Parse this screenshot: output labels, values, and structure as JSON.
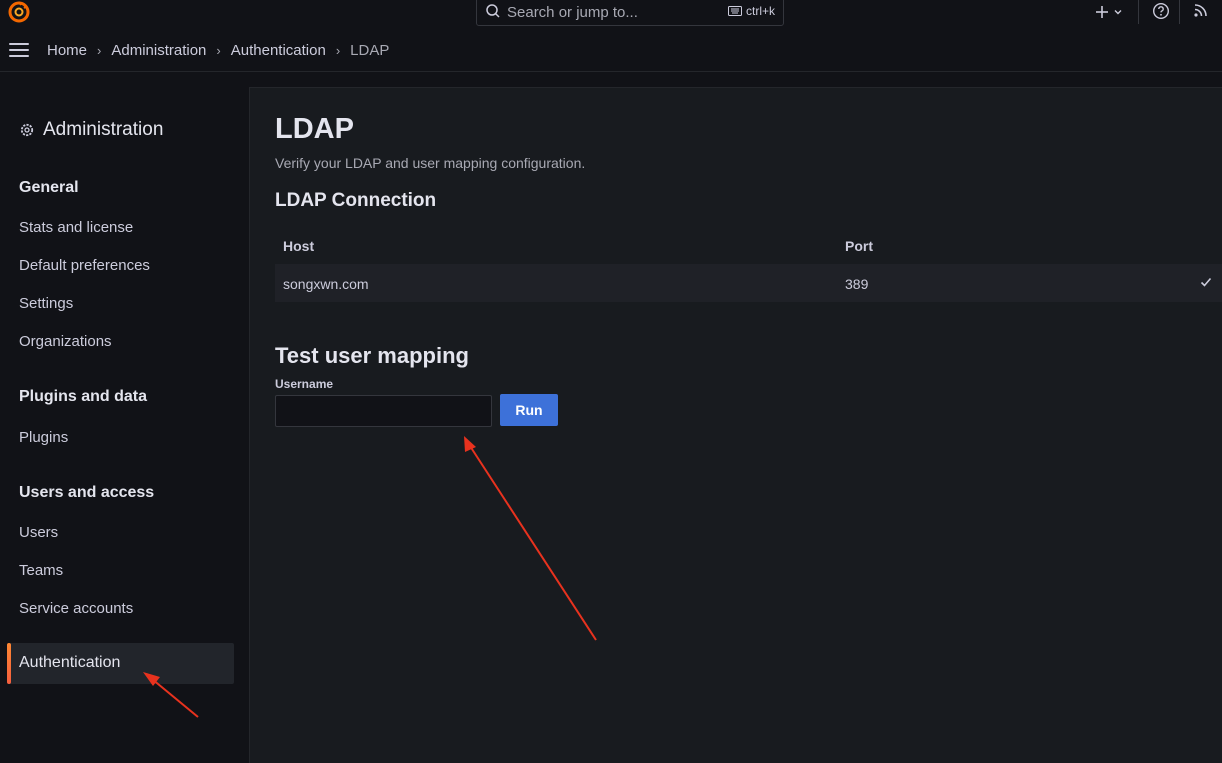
{
  "topbar": {
    "logo_icon": "grafana-logo-icon",
    "search_placeholder": "Search or jump to...",
    "search_shortcut": "ctrl+k",
    "new_icon": "plus-icon",
    "help_icon": "help-icon",
    "news_icon": "rss-icon"
  },
  "breadcrumb": [
    {
      "label": "Home"
    },
    {
      "label": "Administration"
    },
    {
      "label": "Authentication"
    },
    {
      "label": "LDAP"
    }
  ],
  "sidebar": {
    "title": "Administration",
    "sections": {
      "general": "General",
      "plugins": "Plugins and data",
      "users": "Users and access"
    },
    "items": {
      "stats": "Stats and license",
      "default_prefs": "Default preferences",
      "settings": "Settings",
      "organizations": "Organizations",
      "plugins": "Plugins",
      "users": "Users",
      "teams": "Teams",
      "service_accounts": "Service accounts",
      "authentication": "Authentication"
    }
  },
  "main": {
    "title": "LDAP",
    "subtitle": "Verify your LDAP and user mapping configuration.",
    "connection_heading": "LDAP Connection",
    "table": {
      "columns": [
        "Host",
        "Port"
      ],
      "rows": [
        {
          "host": "songxwn.com",
          "port": "389",
          "status_icon": "check-icon"
        }
      ]
    },
    "mapping_heading": "Test user mapping",
    "username_label": "Username",
    "username_value": "",
    "run_label": "Run"
  },
  "colors": {
    "background": "#111217",
    "panel": "#181b1f",
    "primary_button": "#3d71d9",
    "active_accent": "#f55f3e",
    "annotation_arrow": "#e8321e"
  }
}
